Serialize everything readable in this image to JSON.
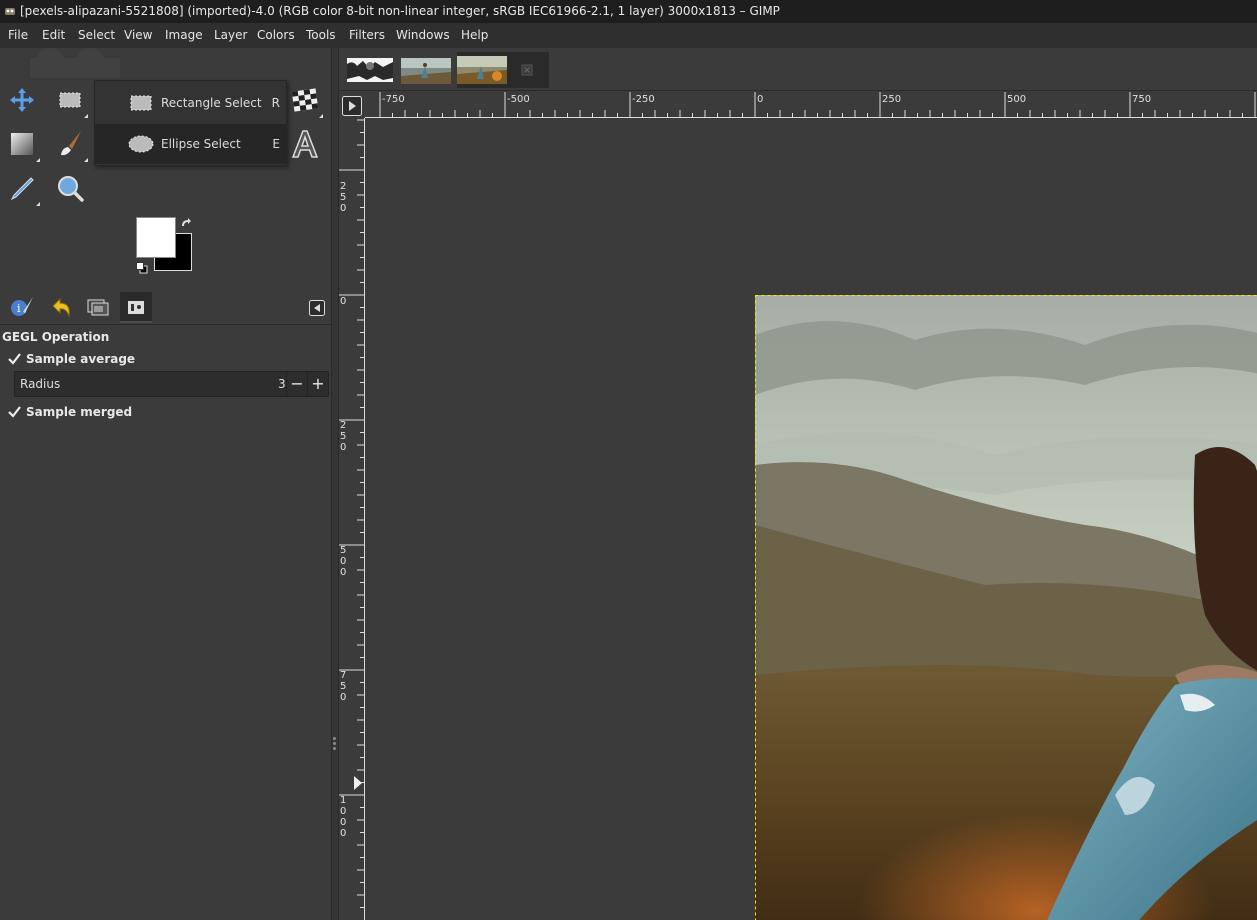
{
  "window": {
    "title": "[pexels-alipazani-5521808] (imported)-4.0 (RGB color 8-bit non-linear integer, sRGB IEC61966-2.1, 1 layer) 3000x1813 – GIMP"
  },
  "menubar": {
    "items": [
      "File",
      "Edit",
      "Select",
      "View",
      "Image",
      "Layer",
      "Colors",
      "Tools",
      "Filters",
      "Windows",
      "Help"
    ]
  },
  "toolbox": {
    "tools": [
      {
        "name": "move-tool",
        "icon": "move-icon"
      },
      {
        "name": "rectangle-select-tool",
        "icon": "rectangle-select-icon"
      },
      {
        "name": "warp-transform-tool",
        "icon": "checker-icon"
      },
      {
        "name": "gradient-tool",
        "icon": "gradient-icon"
      },
      {
        "name": "paintbrush-tool",
        "icon": "paintbrush-icon"
      },
      {
        "name": "text-tool",
        "icon": "text-icon"
      },
      {
        "name": "color-picker-tool",
        "icon": "color-picker-icon"
      },
      {
        "name": "zoom-tool",
        "icon": "magnifier-icon"
      }
    ],
    "flyout": [
      {
        "label": "Rectangle Select",
        "shortcut": "R",
        "selected": false
      },
      {
        "label": "Ellipse Select",
        "shortcut": "E",
        "selected": true
      }
    ],
    "colors": {
      "foreground": "#ffffff",
      "background": "#000000"
    }
  },
  "dock": {
    "tabs": [
      {
        "name": "tool-options-tab",
        "icon": "info-brush-icon"
      },
      {
        "name": "undo-history-tab",
        "icon": "undo-icon"
      },
      {
        "name": "images-tab",
        "icon": "images-icon"
      },
      {
        "name": "device-status-tab",
        "icon": "device-icon"
      }
    ]
  },
  "tool_options": {
    "title": "GEGL Operation",
    "sample_average": {
      "label": "Sample average",
      "checked": true
    },
    "radius": {
      "label": "Radius",
      "value": "3"
    },
    "sample_merged": {
      "label": "Sample merged",
      "checked": true
    }
  },
  "image_tabs": {
    "count": 3
  },
  "rulers": {
    "horizontal": [
      "-750",
      "-500",
      "-250",
      "0",
      "250",
      "500",
      "750"
    ],
    "vertical": [
      "250",
      "0",
      "250",
      "500",
      "750",
      "1000"
    ]
  },
  "colors": {
    "panel_bg": "#3b3b3b",
    "title_bg": "#1e1e1e",
    "selection_border": "#f0f000"
  }
}
